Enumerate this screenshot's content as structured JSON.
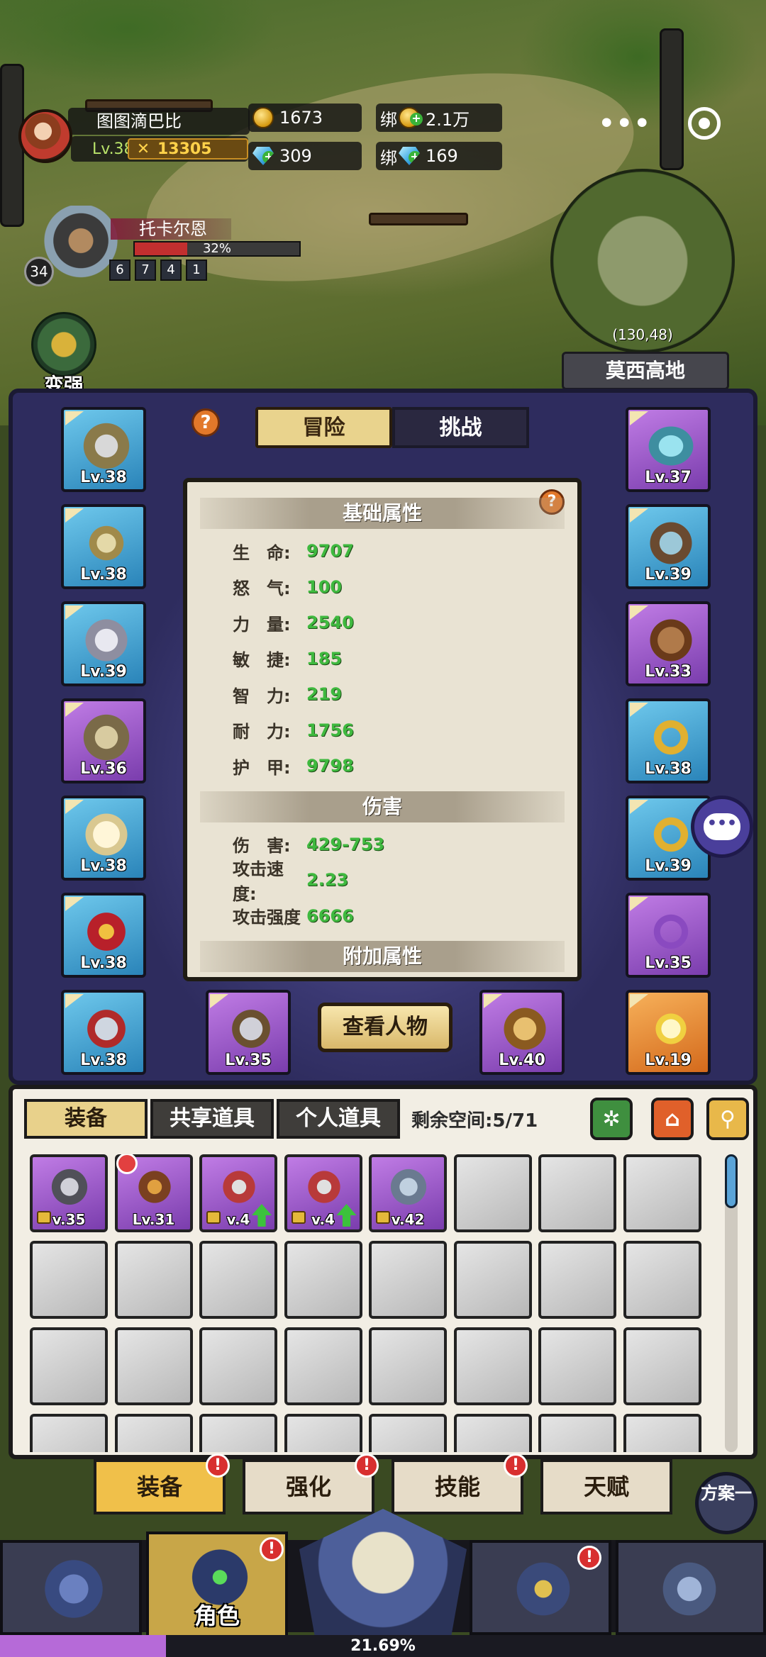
{
  "player": {
    "name": "图图滴巴比",
    "level": "Lv.38",
    "power": "13305"
  },
  "currency": {
    "gold": "1673",
    "bound_gold_label": "绑",
    "bound_gold": "2.1万",
    "diamond": "309",
    "bound_diamond_label": "绑",
    "bound_diamond": "169"
  },
  "boss": {
    "name": "托卡尔恩",
    "level": "34",
    "hp_percent_text": "32%",
    "hp_percent": 0.32,
    "skills": [
      "6",
      "7",
      "4",
      "1"
    ]
  },
  "strengthen_label": "变强",
  "minimap": {
    "coords": "(130,48)",
    "area_name": "莫西高地"
  },
  "mode_tabs": {
    "adventure": "冒险",
    "challenge": "挑战"
  },
  "left_slots": [
    {
      "lv": "Lv.38",
      "color": "blue"
    },
    {
      "lv": "Lv.38",
      "color": "blue"
    },
    {
      "lv": "Lv.39",
      "color": "blue"
    },
    {
      "lv": "Lv.36",
      "color": "purple"
    },
    {
      "lv": "Lv.38",
      "color": "blue"
    },
    {
      "lv": "Lv.38",
      "color": "blue"
    },
    {
      "lv": "Lv.38",
      "color": "blue"
    }
  ],
  "right_slots": [
    {
      "lv": "Lv.37",
      "color": "purple"
    },
    {
      "lv": "Lv.39",
      "color": "blue"
    },
    {
      "lv": "Lv.33",
      "color": "purple"
    },
    {
      "lv": "Lv.38",
      "color": "blue"
    },
    {
      "lv": "Lv.39",
      "color": "blue"
    },
    {
      "lv": "Lv.35",
      "color": "purple"
    },
    {
      "lv": "Lv.19",
      "color": "orange"
    }
  ],
  "bottom_slots": [
    {
      "lv": "Lv.35",
      "color": "purple"
    },
    {
      "lv": "Lv.40",
      "color": "purple"
    }
  ],
  "view_character": "查看人物",
  "stats": {
    "base_header": "基础属性",
    "base": [
      {
        "label": "生　命:",
        "value": "9707"
      },
      {
        "label": "怒　气:",
        "value": "100"
      },
      {
        "label": "力　量:",
        "value": "2540"
      },
      {
        "label": "敏　捷:",
        "value": "185"
      },
      {
        "label": "智　力:",
        "value": "219"
      },
      {
        "label": "耐　力:",
        "value": "1756"
      },
      {
        "label": "护　甲:",
        "value": "9798"
      }
    ],
    "damage_header": "伤害",
    "damage": [
      {
        "label": "伤　害:",
        "value": "429-753"
      },
      {
        "label": "攻击速度:",
        "value": "2.23"
      },
      {
        "label": "攻击强度",
        "value": "6666"
      }
    ],
    "extra_header": "附加属性"
  },
  "inventory": {
    "tabs": [
      "装备",
      "共享道具",
      "个人道具"
    ],
    "space_text": "剩余空间:5/71",
    "items": [
      {
        "lv": "v.35",
        "lock": true,
        "up": false,
        "forbid": false
      },
      {
        "lv": "Lv.31",
        "lock": false,
        "up": false,
        "forbid": true
      },
      {
        "lv": "v.4",
        "lock": true,
        "up": true,
        "forbid": false
      },
      {
        "lv": "v.4",
        "lock": true,
        "up": true,
        "forbid": false
      },
      {
        "lv": "v.42",
        "lock": true,
        "up": false,
        "forbid": false
      }
    ],
    "empty_cells": 27
  },
  "sub_tabs": [
    {
      "label": "装备",
      "badge": "!"
    },
    {
      "label": "强化",
      "badge": "!"
    },
    {
      "label": "技能",
      "badge": "!"
    },
    {
      "label": "天赋",
      "badge": ""
    }
  ],
  "plan_button": "方案一",
  "bottom_nav": {
    "character_label": "角色",
    "badge": "!"
  },
  "progress": {
    "text": "21.69%",
    "fraction": 0.2169
  },
  "colors": {
    "slot_blue": "#2a84b9",
    "slot_purple": "#7a3dad",
    "slot_orange": "#d46a1c",
    "stat_green": "#3fb93f",
    "badge_red": "#d82f2f"
  }
}
